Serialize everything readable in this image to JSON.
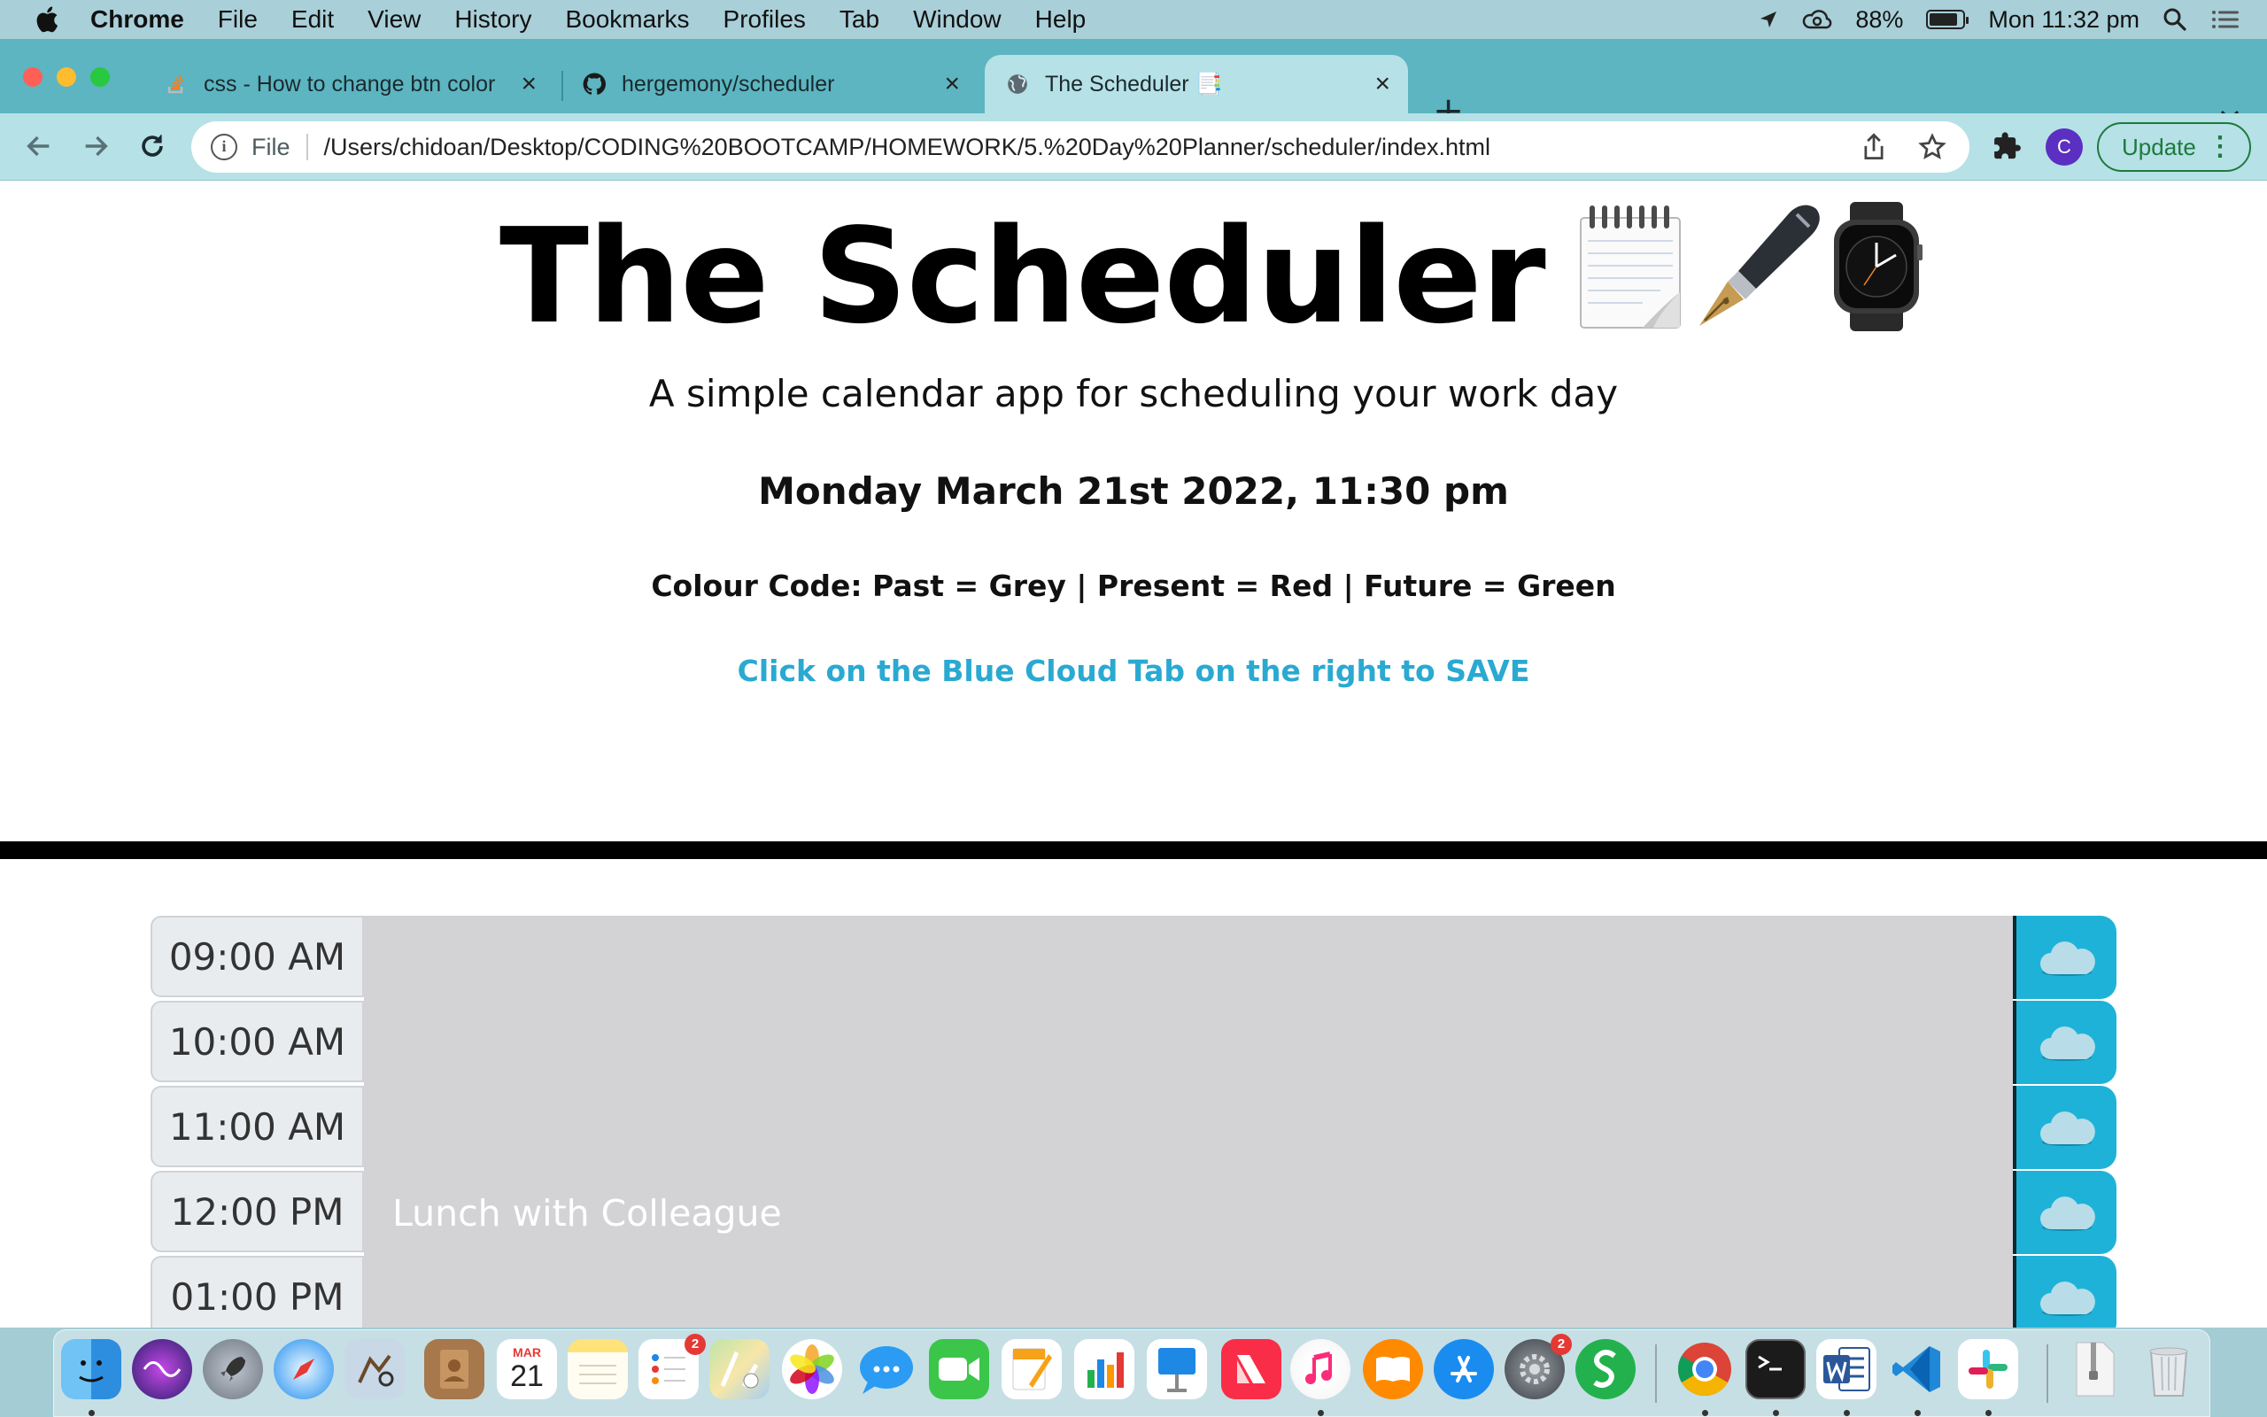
{
  "menubar": {
    "app": "Chrome",
    "items": [
      "File",
      "Edit",
      "View",
      "History",
      "Bookmarks",
      "Profiles",
      "Tab",
      "Window",
      "Help"
    ],
    "battery": "88%",
    "clock": "Mon 11:32 pm"
  },
  "tabs": [
    {
      "title": "css - How to change btn color",
      "active": false
    },
    {
      "title": "hergemony/scheduler",
      "active": false
    },
    {
      "title": "The Scheduler 📑",
      "active": true
    }
  ],
  "toolbar": {
    "scheme": "File",
    "url": "/Users/chidoan/Desktop/CODING%20BOOTCAMP/HOMEWORK/5.%20Day%20Planner/scheduler/index.html",
    "profile_initial": "C",
    "update_label": "Update"
  },
  "page": {
    "title": "The Scheduler",
    "subtitle": "A simple calendar app for scheduling your work day",
    "datetime": "Monday March 21st 2022, 11:30 pm",
    "colour_code": "Colour Code: Past = Grey | Present = Red | Future = Green",
    "save_hint": "Click on the Blue Cloud Tab on the right to SAVE",
    "rows": [
      {
        "hour": "09:00 AM",
        "text": ""
      },
      {
        "hour": "10:00 AM",
        "text": ""
      },
      {
        "hour": "11:00 AM",
        "text": ""
      },
      {
        "hour": "12:00 PM",
        "text": "Lunch with Colleague"
      },
      {
        "hour": "01:00 PM",
        "text": ""
      }
    ]
  },
  "dock": {
    "calendar_month": "MAR",
    "calendar_day": "21",
    "badges": {
      "reminders": "2",
      "system_preferences": "2"
    }
  },
  "colors": {
    "accent_blue": "#1fb2d9",
    "past_grey": "#d3d3d5",
    "update_green": "#1d7a3d"
  }
}
